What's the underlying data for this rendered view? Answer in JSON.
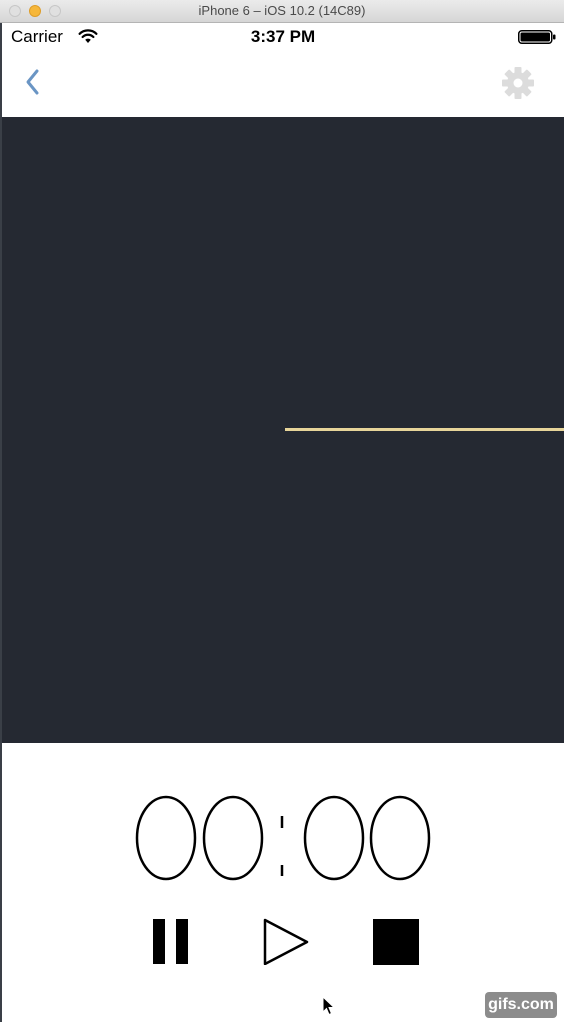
{
  "window": {
    "title": "iPhone 6 – iOS 10.2 (14C89)"
  },
  "status_bar": {
    "carrier": "Carrier",
    "time": "3:37 PM"
  },
  "nav_bar": {
    "back_icon": "chevron-left-icon",
    "settings_icon": "gear-icon"
  },
  "visualizer": {
    "background_color": "#252932",
    "playhead_color": "#e7d59a"
  },
  "timer": {
    "minutes": "00",
    "separator": ":",
    "seconds": "00"
  },
  "controls": {
    "pause_icon": "pause-icon",
    "play_icon": "play-icon",
    "stop_icon": "stop-icon"
  },
  "watermark": {
    "text": "gifs.com"
  }
}
